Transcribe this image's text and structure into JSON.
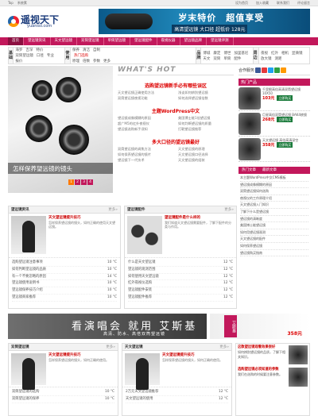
{
  "topbar": {
    "left": [
      "Top",
      "系统素"
    ],
    "right": [
      "设为首页",
      "加入收藏",
      "联系我们",
      "评论留言"
    ]
  },
  "logo": {
    "cn": "遥视天下",
    "en": "yuanssi.com"
  },
  "banner": {
    "line1": "岁末特价　超值享受",
    "line2": "高清望远镜 大口径 超低价 128元"
  },
  "nav": [
    "首页",
    "望远镜资讯",
    "天文望远镜",
    "双筒望远镜",
    "单筒望远镜",
    "望远镜配件",
    "夜视仪器",
    "望远镜品牌",
    "望远镜评测"
  ],
  "subnav": [
    {
      "label": "基础",
      "items": [
        "海罗",
        "吉深",
        "特价",
        "双筒望远镜",
        "口径",
        "专业",
        "报价"
      ]
    },
    {
      "label": "使用",
      "items": [
        "保养",
        "清洁",
        "自制",
        "热门选购",
        "原理",
        "倍数",
        "参数",
        "更多"
      ]
    },
    {
      "label": "品牌",
      "items": [
        "博城",
        "康定",
        "博世",
        "加里基尼",
        "天文",
        "双筒",
        "单筒",
        "配件"
      ]
    },
    {
      "label": "周边",
      "items": [
        "夜视",
        "红外",
        "相机",
        "显微镜",
        "放大镜",
        "测距"
      ]
    }
  ],
  "slide": {
    "caption": "怎样保养望远镜的镜头",
    "pages": [
      "1",
      "2",
      "3",
      "4"
    ]
  },
  "hot": {
    "title": "WHAT'S HOT",
    "blocks": [
      {
        "head": "选购望远镜新手必有哪些误区",
        "rows": [
          "天文望远镜正确使用方法",
          "浅谈如何辨别望远镜",
          "双筒望远镜夜视功能",
          "如何选择望远镜倍数"
        ]
      },
      {
        "head": "主题WordPress中文",
        "rows": [
          "望远镜成像模糊的原因",
          "美国博士能1倍望远镜",
          "超广M5的红外夜视仪",
          "如何判断望远镜的质量",
          "望远镜选购新手须知",
          "打靶望远镜推荐"
        ]
      },
      {
        "head": "多大口径的望远镜最好",
        "rows": [
          "双筒望远镜的调焦方法",
          "天文望远镜的原理",
          "如何保养望远镜的镜片",
          "天文望远镜口径选择",
          "望远镜下一代技术",
          "天文望远镜的组装"
        ]
      }
    ]
  },
  "side": {
    "search_label": "合作服务",
    "title": "热门产品",
    "products": [
      {
        "desc": "千里眼高倍高清双筒望远镜 10X50",
        "price": "103元",
        "buy": "立即购买"
      },
      {
        "desc": "巨星高倍双筒望远镜 BAK4棱镜",
        "price": "268元",
        "buy": "立即购买"
      },
      {
        "desc": "天文望远镜 高倍高清深空",
        "price": "358元",
        "buy": "立即购买"
      }
    ],
    "tabs": [
      "热门文章",
      "最新文章"
    ],
    "list": [
      "本主题WordPress中文CMS模板",
      "望远镜成像模糊的原因",
      "双筒望远镜如何选购",
      "夜视仪的工作原理介绍",
      "天文望远镜入门知识",
      "了解下什么是望远镜",
      "望远镜的清晰度",
      "美国博士能望远镜",
      "如何用望远镜观测",
      "天文望远镜的配件",
      "如何保养望远镜",
      "望远镜购买指南"
    ]
  },
  "sections": [
    {
      "title": "望远镜资讯",
      "more": "更多»",
      "lead": "天文望远镜提升技巧",
      "text": "怎样保养望远镜的镜头，如何正确的使用天文望远镜。",
      "pic": "person",
      "items": [
        [
          "选购望远镜注意事项",
          "10 °C"
        ],
        [
          "如何判断望远镜的品质",
          "10 °C"
        ],
        [
          "有一个不要忽略的原因",
          "14 °C"
        ],
        [
          "望远镜使用说明书",
          "10 °C"
        ],
        [
          "望远镜保养技巧介绍",
          "10 °C"
        ],
        [
          "望远镜商家推荐",
          "10 °C"
        ]
      ]
    },
    {
      "title": "望远镜配件",
      "more": "更多»",
      "lead": "望远镜配件是什么样的",
      "text": "我们知道天文望远镜需要配件，了解下配件的分类与作用。",
      "pic": "lens2",
      "items": [
        [
          "什么是天文望远镜",
          "12 °C"
        ],
        [
          "望远镜的观测范围",
          "12 °C"
        ],
        [
          "如何使用天文望远镜",
          "12 °C"
        ],
        [
          "红外夜视仪选购",
          "12 °C"
        ],
        [
          "望远镜配件安装",
          "12 °C"
        ],
        [
          "望远镜配件推荐",
          "12 °C"
        ]
      ]
    }
  ],
  "ad": {
    "main": "看演唱会 就用 艾斯基",
    "sub": "高清、防水、高倍双筒望远镜",
    "tag": "艾斯基",
    "price": "358元"
  },
  "bottom": [
    {
      "title": "双筒望远镜",
      "more": "更多»",
      "lead": "天文望远镜提升技巧",
      "text": "怎样保养望远镜的镜头，如何正确的使用。",
      "items": [
        [
          "双筒望远镜的选购",
          "10 °C"
        ],
        [
          "双筒望远镜的保养",
          "10 °C"
        ]
      ]
    },
    {
      "title": "天文望远镜",
      "more": "更多»",
      "lead": "天文望远镜提升技巧",
      "text": "怎样保养望远镜的镜头，如何正确的使用。",
      "items": [
        [
          "2万元天文望远镜推荐",
          "12 °C"
        ],
        [
          "天文望远镜的使用",
          "12 °C"
        ]
      ]
    }
  ],
  "rightbox": {
    "t1": "这款望远镜观看效果很好",
    "d1": "如何辨别望远镜的品质，了解下相关知识。",
    "t2": "选购望远镜必须知道的参数",
    "d2": "我们在选购的时候要注意参数。"
  }
}
